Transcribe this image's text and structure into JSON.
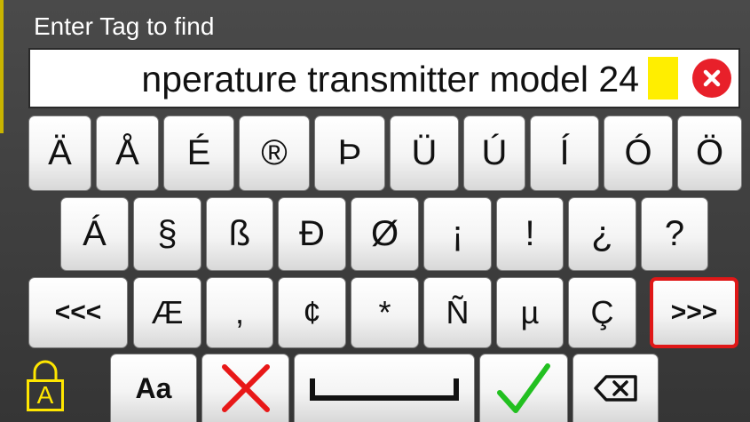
{
  "prompt": "Enter Tag to find",
  "entry_value": "nperature transmitter model 24",
  "row1": [
    "Ä",
    "Å",
    "É",
    "®",
    "Þ",
    "Ü",
    "Ú",
    "Í",
    "Ó",
    "Ö"
  ],
  "row2": [
    "Á",
    "§",
    "ß",
    "Ð",
    "Ø",
    "¡",
    "!",
    "¿",
    "?"
  ],
  "row3": [
    "<<<",
    "Æ",
    ",",
    "¢",
    "*",
    "Ñ",
    "µ",
    "Ç",
    ">>>"
  ],
  "row4": {
    "case_label": "Aa",
    "lock_label": "A"
  },
  "icons": {
    "clear": "clear-circle-x-icon",
    "cancel": "red-x-icon",
    "space": "space-bar-icon",
    "ok": "green-check-icon",
    "backspace": "backspace-icon",
    "lock": "caps-lock-icon"
  },
  "colors": {
    "cursor": "#ffee00",
    "clear": "#e8202a",
    "lock": "#ffe600",
    "check": "#22c020",
    "cancel": "#e81818"
  }
}
